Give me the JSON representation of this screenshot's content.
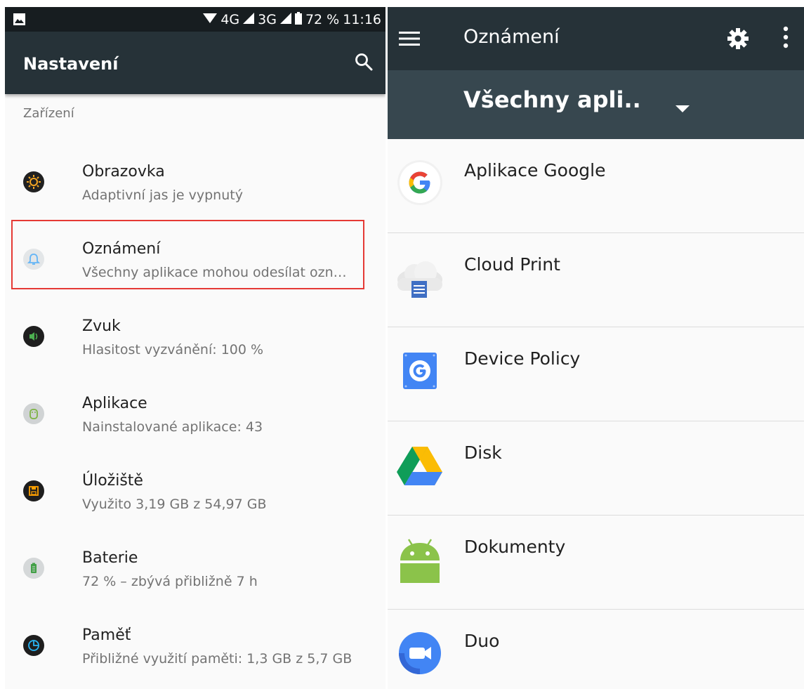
{
  "left": {
    "status_bar": {
      "network_4g": "4G",
      "network_3g": "3G",
      "battery_percent": "72 %",
      "time": "11:16",
      "icons": [
        "image-icon",
        "wifi-icon",
        "signal-icon",
        "signal-icon",
        "battery-icon"
      ]
    },
    "app_bar": {
      "title": "Nastavení",
      "search_icon": "search-icon"
    },
    "section_header": "Zařízení",
    "items": [
      {
        "title": "Obrazovka",
        "subtitle": "Adaptivní jas je vypnutý",
        "icon": "brightness-icon",
        "color": "#f5a623"
      },
      {
        "title": "Oznámení",
        "subtitle": "Všechny aplikace mohou odesílat ozn…",
        "icon": "bell-icon",
        "color": "#64b5f6",
        "highlighted": true
      },
      {
        "title": "Zvuk",
        "subtitle": "Hlasitost vyzvánění: 100 %",
        "icon": "volume-icon",
        "color": "#4caf50"
      },
      {
        "title": "Aplikace",
        "subtitle": "Nainstalované aplikace: 43",
        "icon": "android-icon",
        "color": "#8bc34a"
      },
      {
        "title": "Úložiště",
        "subtitle": "Využito 3,19 GB z 54,97 GB",
        "icon": "storage-icon",
        "color": "#ffa000"
      },
      {
        "title": "Baterie",
        "subtitle": "72 % – zbývá přibližně 7 h",
        "icon": "battery-icon",
        "color": "#43a047"
      },
      {
        "title": "Paměť",
        "subtitle": "Přibližné využití paměti: 1,3 GB z 5,7 GB",
        "icon": "memory-icon",
        "color": "#29b6f6"
      }
    ],
    "highlight_color": "#e53935"
  },
  "right": {
    "app_bar": {
      "title": "Oznámení",
      "menu_icon": "menu-icon",
      "gear_icon": "gear-icon",
      "more_icon": "more-vert-icon"
    },
    "filter": {
      "selected": "Všechny apli..",
      "dropdown_icon": "arrow-drop-down-icon"
    },
    "apps": [
      {
        "name": "Aplikace Google",
        "icon": "google-icon"
      },
      {
        "name": "Cloud Print",
        "icon": "cloud-print-icon"
      },
      {
        "name": "Device Policy",
        "icon": "device-policy-icon"
      },
      {
        "name": "Disk",
        "icon": "drive-icon"
      },
      {
        "name": "Dokumenty",
        "icon": "android-icon"
      },
      {
        "name": "Duo",
        "icon": "duo-icon"
      }
    ]
  },
  "colors": {
    "app_bar": "#263238",
    "sub_bar": "#37474f",
    "status_bar": "#171d20",
    "background": "#fafafa"
  }
}
